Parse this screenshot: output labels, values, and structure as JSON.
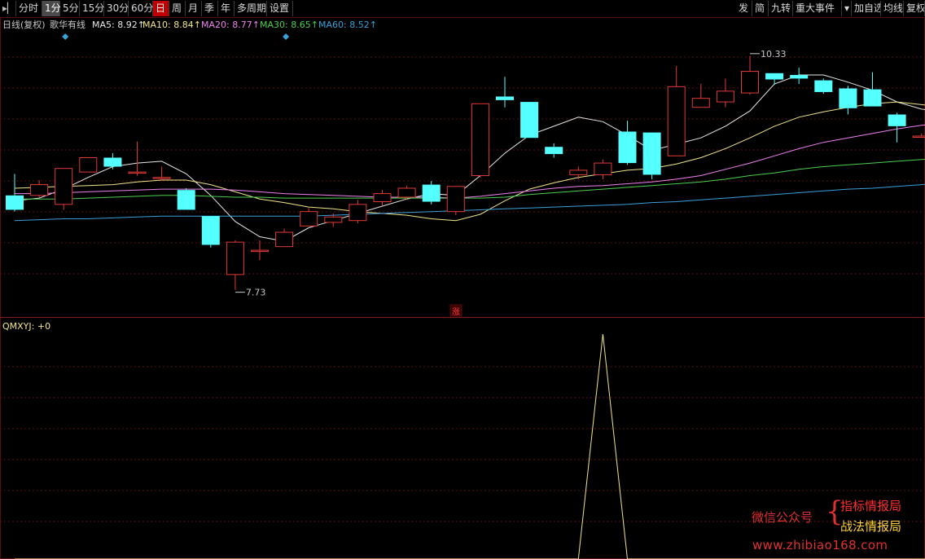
{
  "toolbar": {
    "left_items": [
      {
        "label": "分时",
        "key": "tab-fenshi",
        "state": "normal"
      },
      {
        "label": "1分",
        "key": "tab-1min",
        "state": "active"
      },
      {
        "label": "5分",
        "key": "tab-5min",
        "state": "normal"
      },
      {
        "label": "15分",
        "key": "tab-15min",
        "state": "normal"
      },
      {
        "label": "30分",
        "key": "tab-30min",
        "state": "normal"
      },
      {
        "label": "60分",
        "key": "tab-60min",
        "state": "normal"
      },
      {
        "label": "日",
        "key": "tab-day",
        "state": "red"
      },
      {
        "label": "周",
        "key": "tab-week",
        "state": "normal"
      },
      {
        "label": "月",
        "key": "tab-month",
        "state": "normal"
      },
      {
        "label": "季",
        "key": "tab-quarter",
        "state": "normal"
      },
      {
        "label": "年",
        "key": "tab-year",
        "state": "normal"
      },
      {
        "label": "多周期",
        "key": "tab-multi-period",
        "state": "normal"
      },
      {
        "label": "设置",
        "key": "settings-button",
        "state": "normal"
      }
    ],
    "right_items": [
      {
        "label": "发",
        "key": "fa-button"
      },
      {
        "label": "简",
        "key": "jian-button"
      },
      {
        "label": "九转",
        "key": "jiuzhuan-button"
      },
      {
        "label": "重大事件",
        "key": "major-events-button"
      },
      {
        "label": "▾",
        "key": "events-dropdown"
      },
      {
        "label": "加自选",
        "key": "add-watchlist-button"
      },
      {
        "label": "均线",
        "key": "ma-button"
      },
      {
        "label": "复权",
        "key": "fuquan-button"
      }
    ],
    "pin_icon": "pin-icon"
  },
  "chart_data": {
    "type": "candlestick",
    "main_header": {
      "period": "日线(复权)",
      "name": "歌华有线",
      "ma": [
        {
          "label": "MA5: 8.92↑",
          "color": "#e8e8e8"
        },
        {
          "label": "MA10: 8.84↑",
          "color": "#f0e68c"
        },
        {
          "label": "MA20: 8.77↑",
          "color": "#ee82ee"
        },
        {
          "label": "MA30: 8.65↑",
          "color": "#4cd050"
        },
        {
          "label": "MA60: 8.52↑",
          "color": "#3aa0d8"
        }
      ]
    },
    "ylim": [
      7.5,
      10.7
    ],
    "candles": [
      [
        8.78,
        8.62,
        9.02,
        8.6
      ],
      [
        8.78,
        8.9,
        8.95,
        8.76
      ],
      [
        8.68,
        9.08,
        9.08,
        8.62
      ],
      [
        9.04,
        9.2,
        9.2,
        9.04
      ],
      [
        9.2,
        9.1,
        9.25,
        9.07
      ],
      [
        9.04,
        9.04,
        9.38,
        9.0
      ],
      [
        8.98,
        8.98,
        9.1,
        8.94
      ],
      [
        8.84,
        8.62,
        8.86,
        8.62
      ],
      [
        8.55,
        8.23,
        8.55,
        8.2
      ],
      [
        7.9,
        8.26,
        8.28,
        7.73
      ],
      [
        8.16,
        8.17,
        8.28,
        8.06
      ],
      [
        8.21,
        8.37,
        8.41,
        8.21
      ],
      [
        8.44,
        8.6,
        8.64,
        8.44
      ],
      [
        8.48,
        8.54,
        8.58,
        8.43
      ],
      [
        8.5,
        8.68,
        8.73,
        8.47
      ],
      [
        8.71,
        8.8,
        8.84,
        8.67
      ],
      [
        8.76,
        8.86,
        8.89,
        8.73
      ],
      [
        8.9,
        8.71,
        8.94,
        8.68
      ],
      [
        8.6,
        8.88,
        8.88,
        8.56
      ],
      [
        9.0,
        9.8,
        9.8,
        8.98
      ],
      [
        9.88,
        9.84,
        10.1,
        9.76
      ],
      [
        9.82,
        9.42,
        9.82,
        9.42
      ],
      [
        9.32,
        9.24,
        9.36,
        9.2
      ],
      [
        9.01,
        9.06,
        9.1,
        8.96
      ],
      [
        9.01,
        9.14,
        9.18,
        8.96
      ],
      [
        9.49,
        9.14,
        9.61,
        9.12
      ],
      [
        9.48,
        9.01,
        9.48,
        8.96
      ],
      [
        9.22,
        9.99,
        10.22,
        9.22
      ],
      [
        9.76,
        9.86,
        10.02,
        9.76
      ],
      [
        9.82,
        9.94,
        10.08,
        9.76
      ],
      [
        9.92,
        10.16,
        10.33,
        9.9
      ],
      [
        10.14,
        10.07,
        10.14,
        10.01
      ],
      [
        10.12,
        10.08,
        10.2,
        10.02
      ],
      [
        10.06,
        9.93,
        10.08,
        9.91
      ],
      [
        9.97,
        9.75,
        10.0,
        9.68
      ],
      [
        9.96,
        9.77,
        10.15,
        9.77
      ],
      [
        9.68,
        9.55,
        9.7,
        9.37
      ],
      [
        9.44,
        9.44,
        9.47,
        9.42
      ],
      [
        9.44,
        9.3,
        9.52,
        9.3
      ]
    ],
    "ma_series": [
      {
        "name": "MA5",
        "color": "#e8e8e8",
        "values": [
          8.72,
          8.75,
          8.85,
          8.98,
          9.1,
          9.14,
          9.16,
          9.02,
          8.78,
          8.49,
          8.32,
          8.27,
          8.42,
          8.5,
          8.58,
          8.66,
          8.74,
          8.8,
          8.78,
          9.0,
          9.25,
          9.45,
          9.55,
          9.65,
          9.6,
          9.45,
          9.28,
          9.35,
          9.42,
          9.55,
          9.72,
          10.02,
          10.12,
          10.12,
          10.04,
          9.95,
          9.82,
          9.74,
          9.7
        ]
      },
      {
        "name": "MA10",
        "color": "#f0e68c",
        "values": [
          8.86,
          8.87,
          8.88,
          8.89,
          8.9,
          8.93,
          8.95,
          8.95,
          8.9,
          8.82,
          8.74,
          8.7,
          8.65,
          8.63,
          8.6,
          8.58,
          8.56,
          8.52,
          8.5,
          8.57,
          8.72,
          8.85,
          8.92,
          8.98,
          9.02,
          9.06,
          9.08,
          9.13,
          9.2,
          9.3,
          9.42,
          9.55,
          9.65,
          9.71,
          9.76,
          9.8,
          9.82,
          9.79,
          9.76
        ]
      },
      {
        "name": "MA20",
        "color": "#ee82ee",
        "values": [
          8.8,
          8.8,
          8.81,
          8.82,
          8.83,
          8.84,
          8.85,
          8.85,
          8.85,
          8.84,
          8.82,
          8.8,
          8.79,
          8.78,
          8.77,
          8.76,
          8.76,
          8.76,
          8.75,
          8.77,
          8.8,
          8.83,
          8.86,
          8.88,
          8.89,
          8.91,
          8.93,
          8.96,
          9.0,
          9.07,
          9.14,
          9.22,
          9.3,
          9.37,
          9.42,
          9.47,
          9.52,
          9.56,
          9.59
        ]
      },
      {
        "name": "MA30",
        "color": "#4cd050",
        "values": [
          8.74,
          8.74,
          8.74,
          8.75,
          8.76,
          8.77,
          8.78,
          8.78,
          8.77,
          8.76,
          8.76,
          8.75,
          8.75,
          8.75,
          8.75,
          8.75,
          8.75,
          8.75,
          8.75,
          8.75,
          8.76,
          8.79,
          8.81,
          8.83,
          8.85,
          8.87,
          8.89,
          8.91,
          8.93,
          8.96,
          9.0,
          9.03,
          9.07,
          9.1,
          9.12,
          9.14,
          9.16,
          9.18,
          9.2
        ]
      },
      {
        "name": "MA60",
        "color": "#3aa0d8",
        "values": [
          8.5,
          8.51,
          8.52,
          8.52,
          8.53,
          8.54,
          8.55,
          8.55,
          8.55,
          8.55,
          8.55,
          8.55,
          8.55,
          8.56,
          8.57,
          8.58,
          8.59,
          8.6,
          8.61,
          8.62,
          8.63,
          8.64,
          8.65,
          8.66,
          8.67,
          8.68,
          8.7,
          8.71,
          8.73,
          8.75,
          8.77,
          8.79,
          8.81,
          8.83,
          8.85,
          8.86,
          8.88,
          8.9,
          8.92
        ]
      }
    ],
    "annotations": [
      {
        "index": 9,
        "text": "7.73",
        "at": "low"
      },
      {
        "index": 30,
        "text": "10.33",
        "at": "high"
      }
    ],
    "marker_zhang": "涨",
    "diamond_markers": [
      2,
      11
    ],
    "sub_panel": {
      "label": "QMXYJ: +0",
      "color": "#f0e68c",
      "ylim": [
        0,
        1
      ],
      "values": [
        0,
        0,
        0,
        0,
        0,
        0,
        0,
        0,
        0,
        0,
        0,
        0,
        0,
        0,
        0,
        0,
        0,
        0,
        0,
        0,
        0,
        0,
        0,
        0,
        1,
        0,
        0,
        0,
        0,
        0,
        0,
        0,
        0,
        0,
        0,
        0,
        0,
        0,
        0
      ]
    }
  },
  "watermark": {
    "left": "微信公众号",
    "brace": "{",
    "right_line1": "指标情报局",
    "right_line2": "战法情报局",
    "url": "www.zhibiao168.com"
  }
}
